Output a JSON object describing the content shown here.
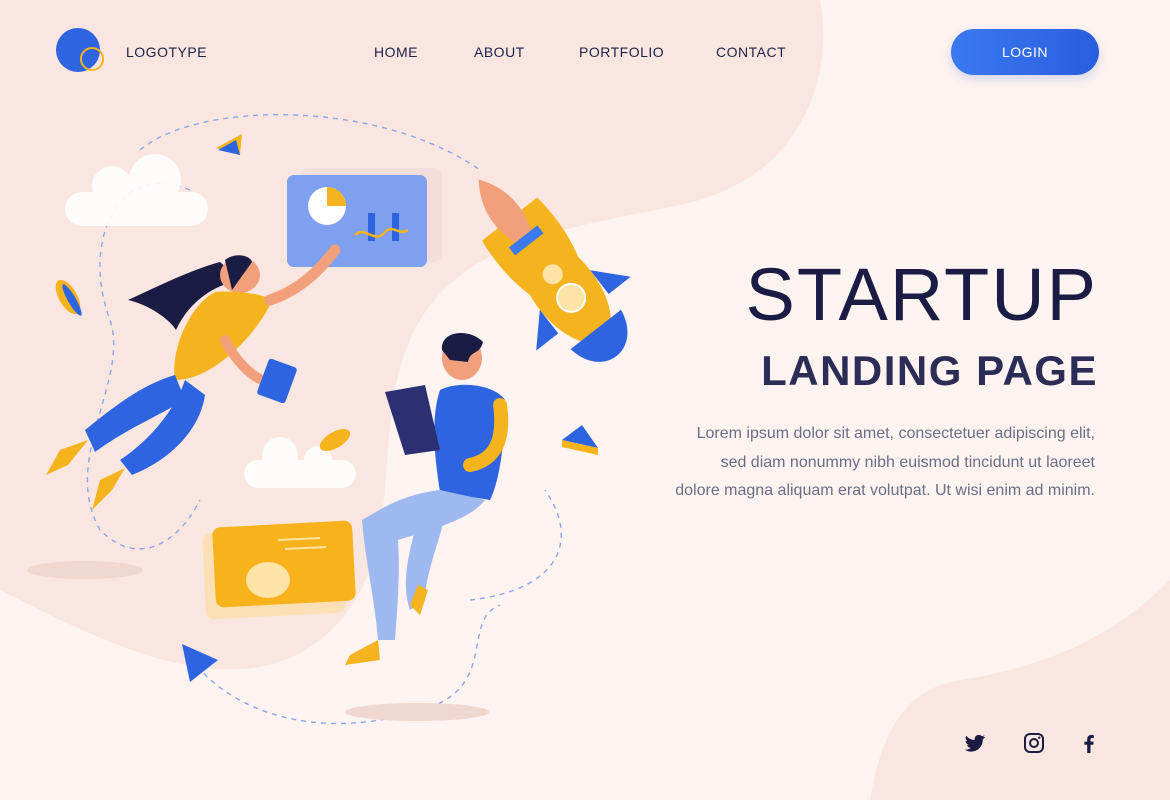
{
  "header": {
    "logo_text": "LOGOTYPE",
    "nav": [
      "HOME",
      "ABOUT",
      "PORTFOLIO",
      "CONTACT"
    ],
    "login_label": "LOGIN"
  },
  "hero": {
    "title": "STARTUP",
    "subtitle": "LANDING PAGE",
    "description": "Lorem ipsum dolor sit amet, consectetuer adipiscing elit, sed diam nonummy nibh euismod tincidunt ut laoreet dolore magna aliquam erat volutpat. Ut wisi enim ad minim."
  },
  "social": [
    "twitter-icon",
    "instagram-icon",
    "facebook-icon"
  ],
  "colors": {
    "background": "#fdf3f0",
    "blob": "#f9e6e0",
    "primary_blue": "#2f64e0",
    "accent_yellow": "#f5b41d",
    "text_dark": "#1b1c44",
    "text_muted": "#6c6e86"
  }
}
